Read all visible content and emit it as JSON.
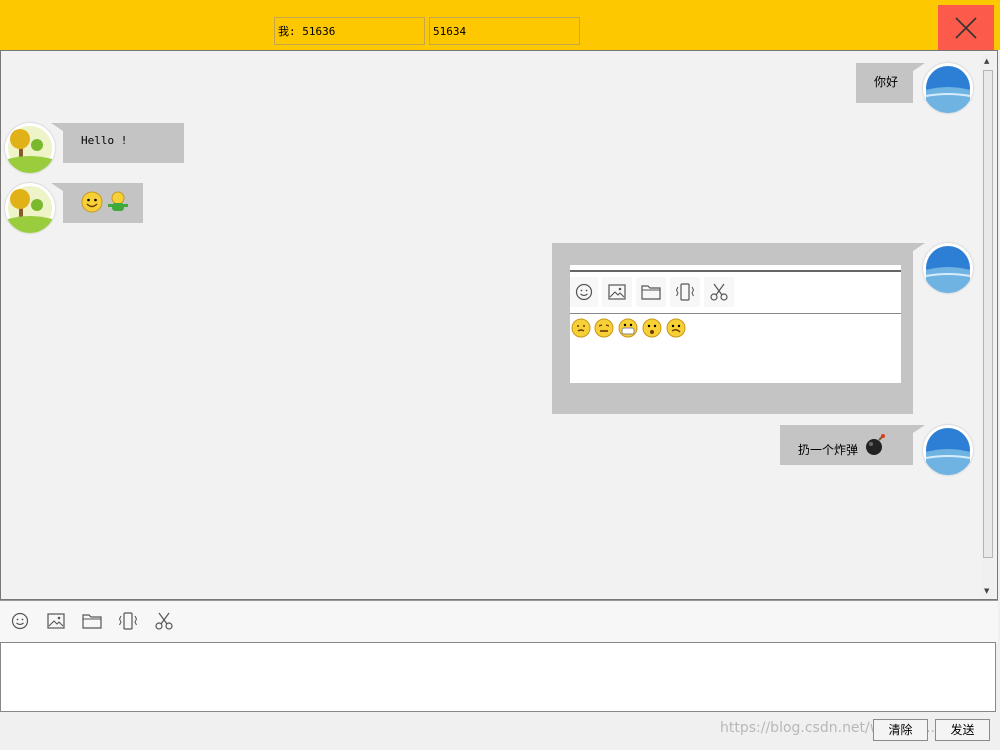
{
  "header": {
    "me_label": "我: 51636",
    "peer_label": "51634",
    "bg_color": "#fec800",
    "close_color": "#fc5b4b",
    "close_icon": "close-x-icon"
  },
  "messages": [
    {
      "side": "right",
      "text": "你好"
    },
    {
      "side": "left",
      "text": "Hello !"
    },
    {
      "side": "left",
      "emojis": [
        "smile-emoji",
        "waving-figure-emoji"
      ]
    },
    {
      "side": "right",
      "type": "screenshot",
      "emojis": [
        "emoji",
        "emoji",
        "emoji",
        "emoji",
        "emoji"
      ]
    },
    {
      "side": "right",
      "text": "扔一个炸弹",
      "icon": "bomb-icon"
    }
  ],
  "toolbar": {
    "icons": [
      "smiley-icon",
      "image-icon",
      "folder-icon",
      "vibrate-icon",
      "scissors-icon"
    ]
  },
  "buttons": {
    "clear": "清除",
    "send": "发送"
  },
  "watermark": "https://blog.csdn.net/weixin_..."
}
